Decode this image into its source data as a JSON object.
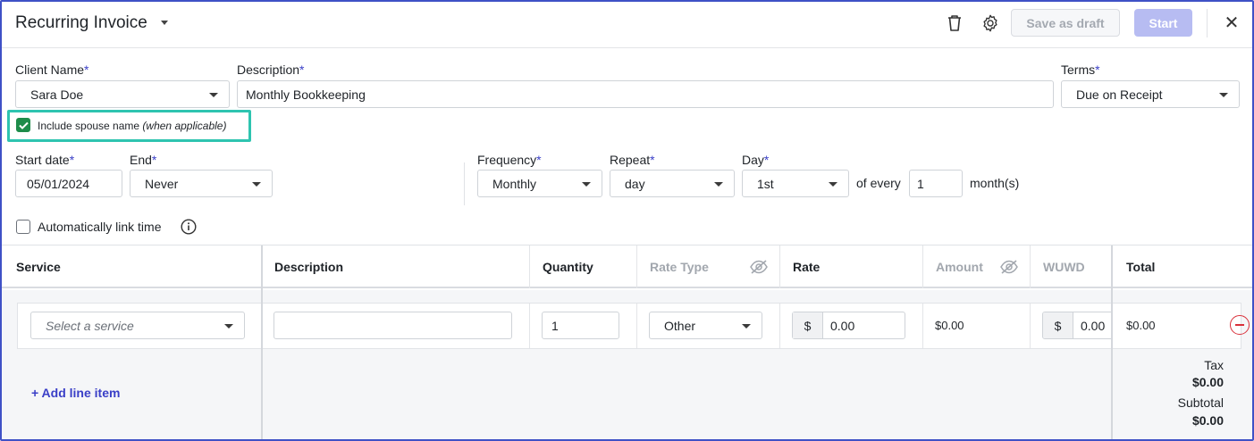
{
  "header": {
    "title": "Recurring Invoice",
    "save_draft_label": "Save as draft",
    "start_label": "Start",
    "close_glyph": "✕",
    "icons": [
      "trash-icon",
      "gear-icon",
      "close-icon"
    ]
  },
  "form": {
    "client_name": {
      "label": "Client Name",
      "value": "Sara Doe"
    },
    "description": {
      "label": "Description",
      "value": "Monthly Bookkeeping"
    },
    "terms": {
      "label": "Terms",
      "value": "Due on Receipt"
    },
    "spouse": {
      "label": "Include spouse name",
      "hint": "(when applicable)",
      "checked": true
    },
    "start_date": {
      "label": "Start date",
      "value": "05/01/2024"
    },
    "end": {
      "label": "End",
      "value": "Never"
    },
    "frequency": {
      "label": "Frequency",
      "value": "Monthly"
    },
    "repeat": {
      "label": "Repeat",
      "value": "day"
    },
    "day": {
      "label": "Day",
      "value": "1st"
    },
    "of_every_label": "of every",
    "every_value": "1",
    "months_label": "month(s)",
    "auto_link": {
      "label": "Automatically link time",
      "checked": false
    },
    "required_mark": "*"
  },
  "table": {
    "columns": [
      "Service",
      "Description",
      "Quantity",
      "Rate Type",
      "Rate",
      "Amount",
      "WUWD",
      "Total"
    ],
    "row": {
      "service_placeholder": "Select a service",
      "description": "",
      "quantity": "1",
      "rate_type": "Other",
      "rate_prefix": "$",
      "rate": "0.00",
      "amount": "$0.00",
      "wuwd_prefix": "$",
      "wuwd": "0.00",
      "total": "$0.00"
    },
    "add_line_label": "+ Add line item",
    "summary": {
      "tax_label": "Tax",
      "tax_value": "$0.00",
      "subtotal_label": "Subtotal",
      "subtotal_value": "$0.00"
    }
  },
  "colors": {
    "accent": "#3a3fc7",
    "highlight": "#2ec4b0",
    "check": "#1e8c4a",
    "remove": "#d9303a"
  }
}
